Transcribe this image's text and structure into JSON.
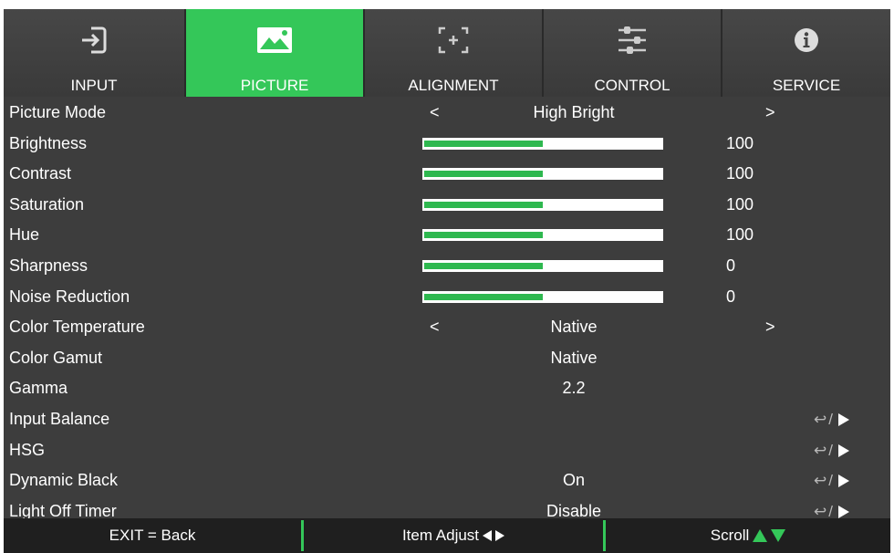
{
  "tabs": [
    {
      "label": "INPUT",
      "icon": "input-icon",
      "active": false
    },
    {
      "label": "PICTURE",
      "icon": "picture-icon",
      "active": true
    },
    {
      "label": "ALIGNMENT",
      "icon": "alignment-icon",
      "active": false
    },
    {
      "label": "CONTROL",
      "icon": "control-sliders-icon",
      "active": false
    },
    {
      "label": "SERVICE",
      "icon": "info-icon",
      "active": false
    }
  ],
  "rows": [
    {
      "name": "Picture Mode",
      "type": "selector",
      "prev": "<",
      "value": "High Bright",
      "next": ">"
    },
    {
      "name": "Brightness",
      "type": "slider",
      "value": "100",
      "fill": 0.5
    },
    {
      "name": "Contrast",
      "type": "slider",
      "value": "100",
      "fill": 0.5
    },
    {
      "name": "Saturation",
      "type": "slider",
      "value": "100",
      "fill": 0.5
    },
    {
      "name": "Hue",
      "type": "slider",
      "value": "100",
      "fill": 0.5
    },
    {
      "name": "Sharpness",
      "type": "slider",
      "value": "0",
      "fill": 0.5
    },
    {
      "name": "Noise Reduction",
      "type": "slider",
      "value": "0",
      "fill": 0.5
    },
    {
      "name": "Color Temperature",
      "type": "selector",
      "prev": "<",
      "value": "Native",
      "next": ">"
    },
    {
      "name": "Color Gamut",
      "type": "value",
      "value": "Native"
    },
    {
      "name": "Gamma",
      "type": "value",
      "value": "2.2"
    },
    {
      "name": "Input Balance",
      "type": "enter",
      "value": ""
    },
    {
      "name": "HSG",
      "type": "enter",
      "value": ""
    },
    {
      "name": "Dynamic Black",
      "type": "enter",
      "value": "On"
    },
    {
      "name": "Light Off Timer",
      "type": "enter",
      "value": "Disable"
    }
  ],
  "footer": {
    "exit": "EXIT = Back",
    "adjust": "Item Adjust",
    "scroll": "Scroll"
  },
  "colors": {
    "accent": "#34c759",
    "panel": "#3d3d3d",
    "footer": "#1f1f1f"
  }
}
